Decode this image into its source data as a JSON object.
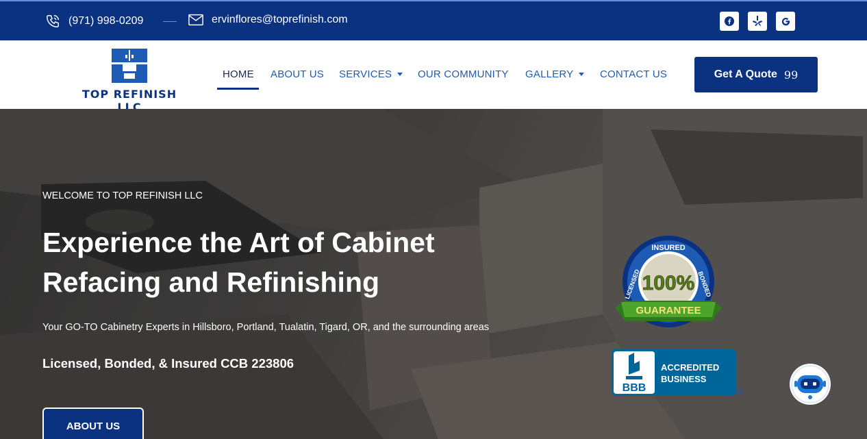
{
  "topbar": {
    "phone": "(971) 998-0209",
    "email": "ervinflores@toprefinish.com",
    "social": [
      {
        "name": "facebook-icon",
        "color": "#1877f2"
      },
      {
        "name": "yelp-icon",
        "color": "#0b3181"
      },
      {
        "name": "google-icon",
        "color": "#0b3181"
      }
    ]
  },
  "logo": {
    "text": "TOP REFINISH LLC"
  },
  "nav": {
    "items": [
      {
        "label": "HOME",
        "active": true
      },
      {
        "label": "ABOUT US"
      },
      {
        "label": "SERVICES",
        "dropdown": true
      },
      {
        "label": "OUR COMMUNITY"
      },
      {
        "label": "GALLERY",
        "dropdown": true
      },
      {
        "label": "CONTACT US"
      }
    ],
    "quote_label": "Get A Quote"
  },
  "hero": {
    "eyebrow": "WELCOME TO TOP REFINISH LLC",
    "headline_line1": "Experience the Art of Cabinet",
    "headline_line2": "Refacing and Refinishing",
    "subline": "Your GO-TO Cabinetry Experts in Hillsboro, Portland, Tualatin, Tigard, OR, and the surrounding areas",
    "license": "Licensed, Bonded, & Insured CCB 223806",
    "button": "ABOUT US"
  },
  "badge": {
    "top_text": "INSURED",
    "left_text": "LICENSED",
    "right_text": "BONDED",
    "percent": "100%",
    "ribbon": "GUARANTEE"
  },
  "bbb": {
    "logo_text": "BBB",
    "line1": "ACCREDITED",
    "line2": "BUSINESS",
    "reg": "®"
  },
  "colors": {
    "primary": "#0b3181",
    "nav_text": "#1e5bb5",
    "bbb": "#006699"
  }
}
